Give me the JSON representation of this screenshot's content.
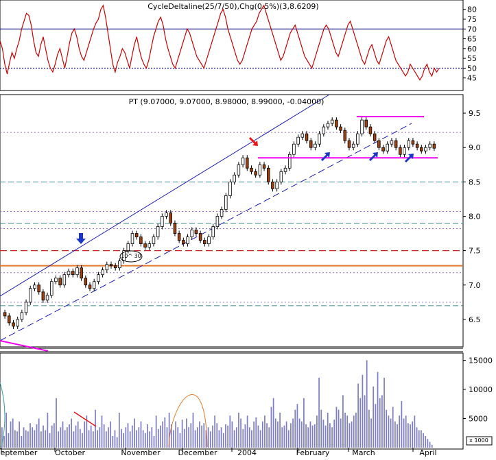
{
  "colors": {
    "panel_border": "#000000",
    "osc_line": "#cc0000",
    "ref_line": "#000080",
    "channel": "#1a1ab8",
    "magenta": "#ee00ee",
    "arrow_blue": "#1a35c8",
    "arrow_red": "#ee1111",
    "candle_up": "#ffffff",
    "candle_down": "#a0400c",
    "volume_bar": "#7e7ec6",
    "orange_line": "#e07a2a",
    "red_dash": "#cc2222",
    "teal_dash": "#3a8a8a"
  },
  "chart_data": [
    {
      "type": "line",
      "title": "CycleDeltaline(25/7/50),Chg(0.5%)(3,8.6209)",
      "ylim": [
        40,
        82
      ],
      "y_ticks": [
        "80",
        "75",
        "70",
        "65",
        "60",
        "55",
        "50",
        "45"
      ],
      "reference_lines": [
        70,
        50
      ],
      "series": [
        {
          "values": [
            64,
            60,
            52,
            47,
            53,
            58,
            55,
            60,
            64,
            70,
            74,
            78,
            77,
            72,
            64,
            58,
            56,
            62,
            66,
            60,
            54,
            50,
            48,
            52,
            57,
            60,
            55,
            50,
            56,
            63,
            68,
            70,
            66,
            60,
            56,
            54,
            58,
            62,
            66,
            70,
            73,
            75,
            80,
            82,
            76,
            68,
            60,
            52,
            48,
            53,
            56,
            60,
            58,
            54,
            50,
            56,
            62,
            66,
            60,
            55,
            52,
            50,
            54,
            60,
            66,
            70,
            74,
            76,
            72,
            65,
            60,
            56,
            52,
            50,
            54,
            58,
            62,
            66,
            70,
            68,
            64,
            60,
            56,
            54,
            52,
            50,
            54,
            58,
            62,
            66,
            70,
            74,
            78,
            80,
            76,
            70,
            66,
            62,
            58,
            54,
            52,
            54,
            58,
            62,
            66,
            70,
            72,
            74,
            78,
            80,
            82,
            78,
            74,
            70,
            66,
            62,
            58,
            54,
            56,
            60,
            64,
            68,
            70,
            72,
            68,
            64,
            60,
            56,
            54,
            52,
            50,
            54,
            58,
            62,
            66,
            70,
            72,
            70,
            66,
            62,
            58,
            56,
            60,
            64,
            68,
            72,
            74,
            70,
            66,
            62,
            58,
            54,
            52,
            56,
            60,
            62,
            58,
            54,
            52,
            56,
            60,
            64,
            66,
            62,
            58,
            54,
            52,
            50,
            48,
            46,
            48,
            52,
            50,
            48,
            46,
            44,
            46,
            50,
            52,
            48,
            46,
            50,
            48,
            50
          ]
        }
      ]
    },
    {
      "type": "candlestick",
      "title": "PT (9.07000, 9.07000, 8.98000, 8.99000, -0.04000)",
      "ylim": [
        6.1,
        9.75
      ],
      "y_ticks": [
        "9.5",
        "9.0",
        "8.5",
        "8.0",
        "7.5",
        "7.0",
        "6.5"
      ],
      "close": [
        6.55,
        6.45,
        6.4,
        6.5,
        6.6,
        6.75,
        6.95,
        7.0,
        6.9,
        6.78,
        6.85,
        7.05,
        7.1,
        7.0,
        7.15,
        7.2,
        7.15,
        7.25,
        7.1,
        7.0,
        6.95,
        7.05,
        7.15,
        7.22,
        7.3,
        7.28,
        7.25,
        7.35,
        7.5,
        7.6,
        7.75,
        7.7,
        7.6,
        7.55,
        7.6,
        7.7,
        7.85,
        8.0,
        8.05,
        7.9,
        7.75,
        7.65,
        7.6,
        7.7,
        7.8,
        7.75,
        7.65,
        7.6,
        7.7,
        7.85,
        8.0,
        8.1,
        8.3,
        8.5,
        8.6,
        8.75,
        8.85,
        8.7,
        8.65,
        8.6,
        8.75,
        8.7,
        8.5,
        8.4,
        8.5,
        8.65,
        8.7,
        8.9,
        9.05,
        9.15,
        9.2,
        9.1,
        9.0,
        9.05,
        9.2,
        9.3,
        9.35,
        9.4,
        9.3,
        9.25,
        9.1,
        9.0,
        9.05,
        9.2,
        9.4,
        9.3,
        9.2,
        9.1,
        9.0,
        8.95,
        9.05,
        9.1,
        9.0,
        8.9,
        9.0,
        9.1,
        9.05,
        9.0,
        8.95,
        9.0,
        9.05,
        8.99
      ],
      "reference_lines": {
        "magenta_solid": [
          9.45,
          8.85
        ],
        "orange_solid": [
          7.28
        ],
        "red_dashed": [
          7.5
        ],
        "teal_dashed": [
          8.5,
          7.9,
          6.7
        ],
        "purple_dotted": [
          9.22,
          8.07,
          7.82,
          7.18,
          6.75
        ]
      },
      "annotations": {
        "circle_label": "10^ 30",
        "blue_arrows": 4,
        "red_arrows": 1
      }
    },
    {
      "type": "bar",
      "ylim": [
        0,
        16000
      ],
      "y_ticks": [
        "15000",
        "10000",
        "5000"
      ],
      "y_unit_label": "x 1000",
      "categories": [
        "September",
        "October",
        "November",
        "December",
        "2004",
        "February",
        "March",
        "April"
      ],
      "values": [
        3500,
        2000,
        6000,
        2500,
        4500,
        5000,
        3000,
        2800,
        4500,
        2000,
        3500,
        3000,
        2800,
        4200,
        3500,
        3000,
        4000,
        5000,
        2800,
        3800,
        3000,
        6000,
        2500,
        3800,
        4200,
        8500,
        2800,
        3500,
        4500,
        3000,
        3500,
        4000,
        5000,
        2800,
        3800,
        4500,
        3200,
        2500,
        4500,
        5500,
        3000,
        3800,
        2800,
        6500,
        3000,
        3500,
        5500,
        4000,
        2800,
        3500,
        4500,
        2000,
        3000,
        1800,
        6000,
        3200,
        2500,
        3500,
        4200,
        2800,
        3800,
        5000,
        3000,
        3500,
        4500,
        3000,
        2500,
        4000,
        2800,
        3500,
        2000,
        5500,
        3200,
        3800,
        4500,
        5200,
        3500,
        6000,
        4000,
        3000,
        4500,
        3500,
        2500,
        4800,
        3200,
        5000,
        3500,
        4200,
        6000,
        3000,
        3500,
        4500,
        3800,
        4200,
        3000,
        3500,
        2800,
        3800,
        5500,
        4200,
        3000,
        3500,
        2500,
        4000,
        3800,
        5500,
        4500,
        3000,
        3500,
        6000,
        5000,
        3200,
        4000,
        5500,
        3500,
        3000,
        4500,
        5200,
        3800,
        3000,
        4500,
        5500,
        4200,
        3500,
        7000,
        8500,
        5000,
        4500,
        6000,
        3500,
        3800,
        4500,
        3000,
        4200,
        5000,
        6500,
        7500,
        5000,
        4500,
        8500,
        4000,
        3500,
        4500,
        3800,
        4000,
        5500,
        12000,
        6500,
        4800,
        3800,
        6000,
        4200,
        3500,
        4800,
        7000,
        6500,
        5000,
        9000,
        6000,
        5500,
        4200,
        4500,
        5500,
        6000,
        11000,
        8500,
        12500,
        9000,
        15000,
        6500,
        5000,
        10500,
        7500,
        13000,
        8500,
        9000,
        12000,
        6500,
        5500,
        5000,
        7000,
        4500,
        4000,
        5500,
        8000,
        5000,
        5500,
        4200,
        4000,
        4500,
        5500,
        3500,
        3000,
        3000,
        2500,
        2000,
        1500,
        1000,
        500
      ]
    }
  ]
}
